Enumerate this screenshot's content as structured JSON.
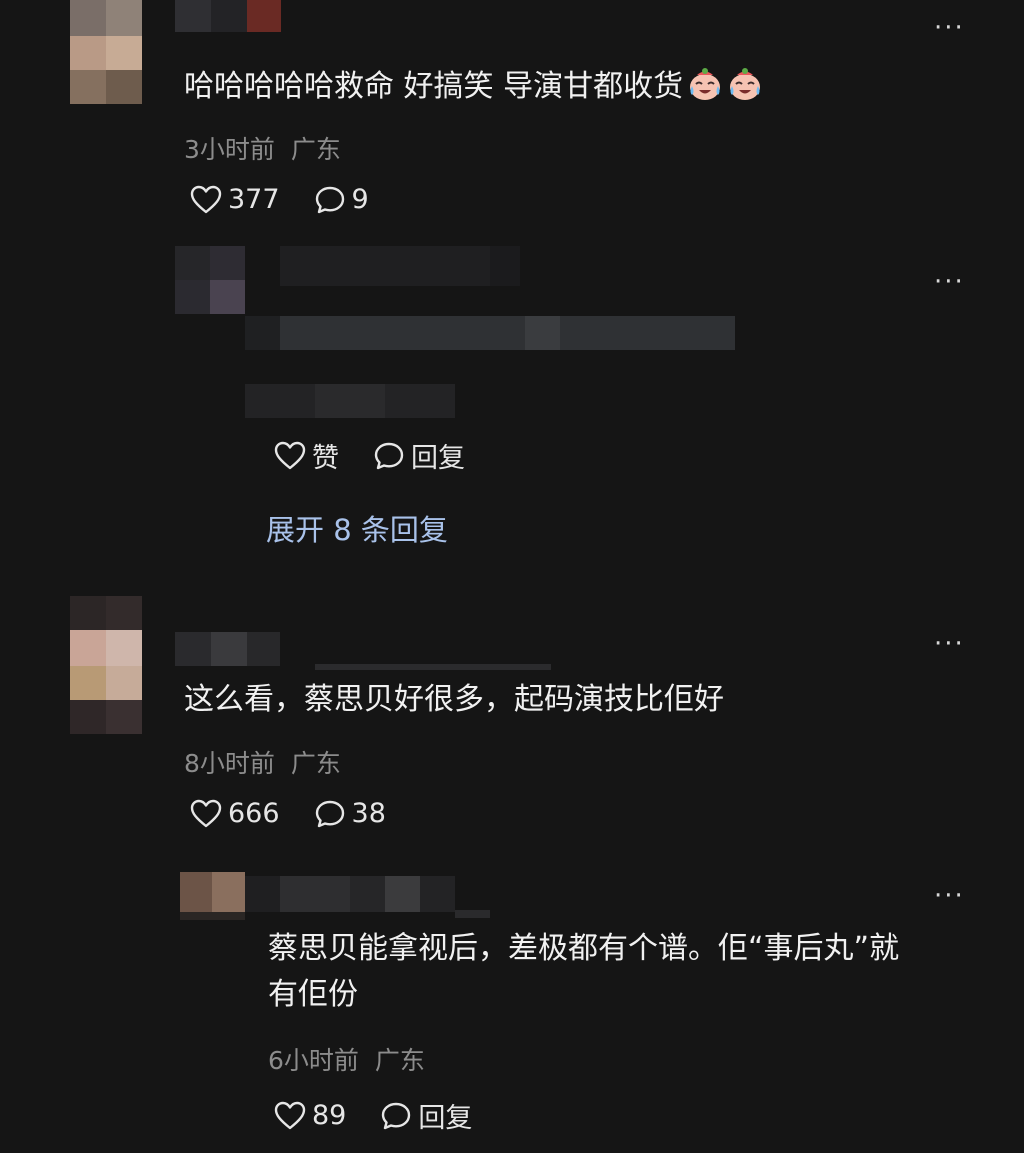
{
  "comments": [
    {
      "text": "哈哈哈哈哈救命 好搞笑 导演甘都收货",
      "emoji": "crying-laughing-emoji",
      "time": "3小时前",
      "location": "广东",
      "likes": "377",
      "replies": "9",
      "reply": {
        "like_label": "赞",
        "reply_label": "回复"
      },
      "expand_label": "展开 8 条回复"
    },
    {
      "text": "这么看，蔡思贝好很多，起码演技比佢好",
      "time": "8小时前",
      "location": "广东",
      "likes": "666",
      "replies": "38",
      "reply": {
        "text_line1": "蔡思贝能拿视后，差极都有个谱。佢“事后丸”就",
        "text_line2": "有佢份",
        "time": "6小时前",
        "location": "广东",
        "likes": "89",
        "reply_label": "回复"
      }
    }
  ],
  "more_glyph": "···",
  "colors": {
    "background": "#151515",
    "text": "#f1f1f1",
    "meta": "#8c8c8c",
    "link": "#a9c2ea"
  },
  "icons": [
    "heart-icon",
    "comment-bubble-icon",
    "more-icon",
    "crying-laughing-emoji"
  ]
}
